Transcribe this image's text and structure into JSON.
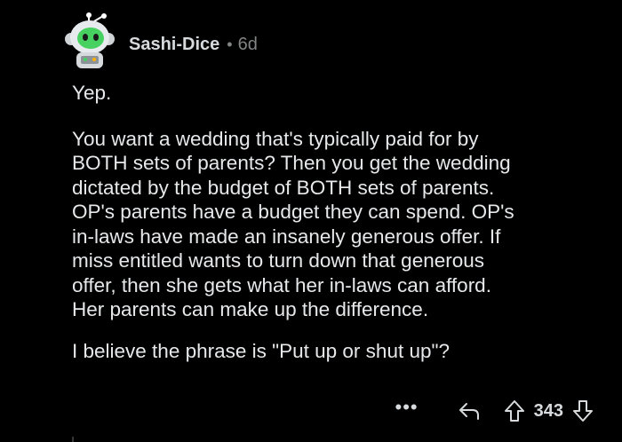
{
  "comment": {
    "author": "Sashi-Dice",
    "separator": "•",
    "age": "6d",
    "paragraphs": [
      "Yep.",
      "You want a wedding that's typically paid for by\nBOTH sets of parents? Then you get the wedding\ndictated by the budget of BOTH sets of parents.\nOP's parents have a budget they can spend. OP's\nin-laws have made an insanely generous offer. If\nmiss entitled wants to turn down that generous\noffer, then she gets what her in-laws can afford.\nHer parents can make up the difference.",
      "I believe the phrase is \"Put up or shut up\"?"
    ],
    "score": "343"
  },
  "actions": {
    "more_label": "•••"
  },
  "icons": {
    "avatar": "snoo-avatar-green-helmet",
    "reply": "reply-icon",
    "upvote": "upvote-icon",
    "downvote": "downvote-icon",
    "more": "more-options-icon"
  },
  "colors": {
    "background": "#000000",
    "text": "#d7dadc",
    "meta": "#818384",
    "avatar_accent": "#46d160"
  }
}
